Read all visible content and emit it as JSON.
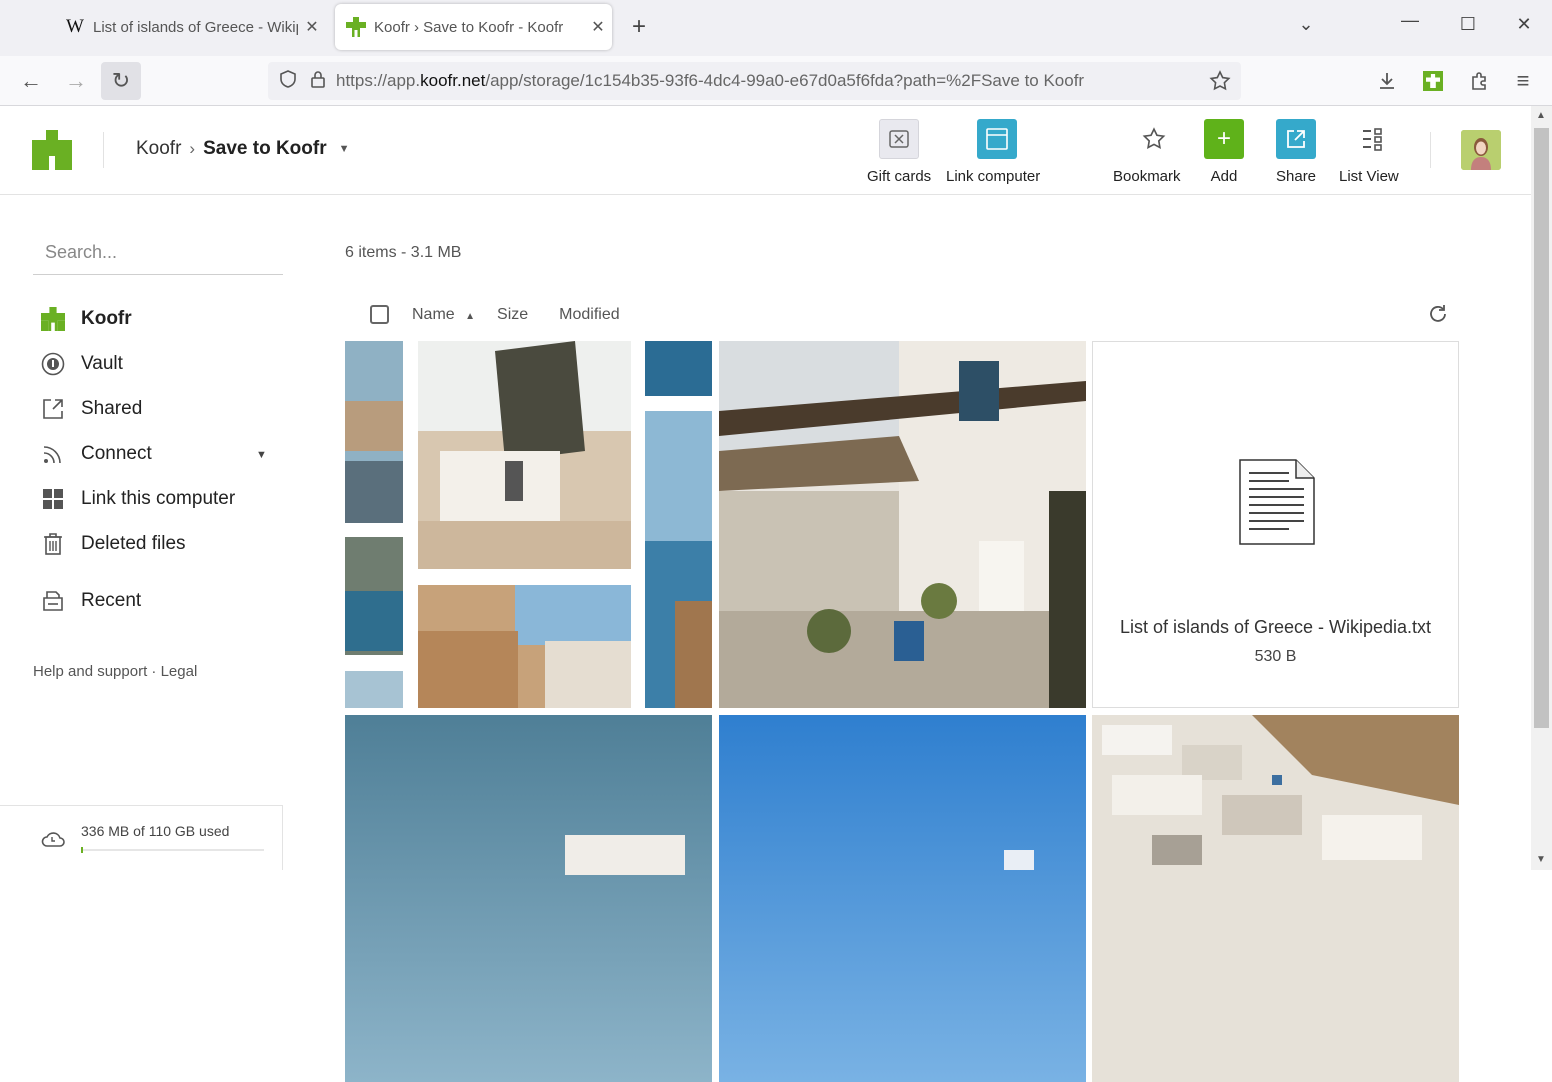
{
  "browser": {
    "tabs": [
      {
        "title": "List of islands of Greece - Wikip",
        "favicon": "W"
      },
      {
        "title": "Koofr › Save to Koofr - Koofr"
      }
    ],
    "url_prefix": "https://app.",
    "url_domain": "koofr.net",
    "url_rest": "/app/storage/1c154b35-93f6-4dc4-99a0-e67d0a5f6fda?path=%2FSave to Koofr"
  },
  "header": {
    "breadcrumb_root": "Koofr",
    "breadcrumb_current": "Save to Koofr",
    "buttons": {
      "gift_cards": "Gift cards",
      "link_computer": "Link computer",
      "bookmark": "Bookmark",
      "add": "Add",
      "share": "Share",
      "list_view": "List View"
    }
  },
  "sidebar": {
    "search_placeholder": "Search...",
    "items": [
      {
        "label": "Koofr"
      },
      {
        "label": "Vault"
      },
      {
        "label": "Shared"
      },
      {
        "label": "Connect"
      },
      {
        "label": "Link this computer"
      },
      {
        "label": "Deleted files"
      },
      {
        "label": "Recent"
      }
    ],
    "help": "Help and support",
    "legal": "Legal",
    "storage_text": "336 MB of 110 GB used",
    "storage_fraction": 0.003
  },
  "content": {
    "summary": "6 items - 3.1 MB",
    "columns": {
      "name": "Name",
      "size": "Size",
      "modified": "Modified"
    },
    "file": {
      "name": "List of islands of Greece - Wikipedia.txt",
      "size": "530 B"
    }
  },
  "colors": {
    "brand_green": "#6ab023",
    "add_green": "#5fb21a",
    "teal": "#35a9cb"
  }
}
